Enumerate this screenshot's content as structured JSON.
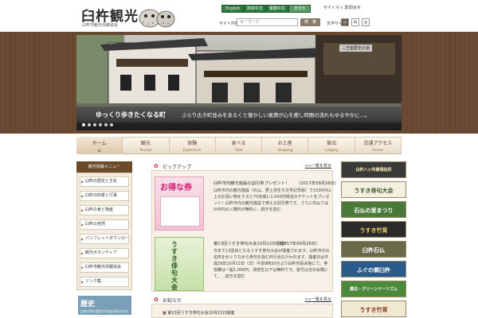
{
  "header": {
    "logo_title": "臼杵観光",
    "logo_sub": "臼杵市観光情報協会",
    "languages": [
      "English",
      "简体中文",
      "繁體中文",
      "한국어"
    ],
    "links": [
      "サイトマップ",
      "お問合せ"
    ],
    "search_label": "サイト内検索",
    "search_placeholder": "キーワード",
    "search_button": "検　索",
    "fontsize_label": "文字サイズ",
    "fontsizes": [
      "小",
      "中",
      "大"
    ]
  },
  "hero": {
    "caption_left": "ゆっくり歩きたくなる町",
    "caption": "ぶらり古き町並みをあるくと懐かしい風情が心を癒し時間の流れもゆるやかに…。",
    "tag": "二王座歴史の道",
    "slide_count": 6,
    "active_slide": 0
  },
  "nav": [
    {
      "jp": "ホーム",
      "en": ""
    },
    {
      "jp": "観光",
      "en": "Tourism"
    },
    {
      "jp": "体験",
      "en": "Experience"
    },
    {
      "jp": "食べる",
      "en": "Food"
    },
    {
      "jp": "お土産",
      "en": "Shopping"
    },
    {
      "jp": "宿泊",
      "en": "Lodging"
    },
    {
      "jp": "交通アクセス",
      "en": "Access"
    }
  ],
  "sidebar": {
    "title": "観光情報メニュー",
    "items": [
      "臼杵の歴史と文化",
      "臼杵の四季と行事",
      "臼杵の食と物産",
      "臼杵の自然",
      "パンフレットダウンロード",
      "観光ボランティア",
      "臼杵市観光情報協会",
      "リンク集"
    ],
    "banner_title": "歴史",
    "banner_text": "臼杵の町の歴史や文化を紹介する情報"
  },
  "main": {
    "pickup": {
      "title": "ピックアップ",
      "more": ">>一覧を見る",
      "articles": [
        {
          "image_text": "お得な券",
          "title": "臼杵市内観光施設の割引券プレゼント！",
          "date": "（2017年09月26日）",
          "body": "臼杵市内の観光施設（石仏、野上弥生子文学記念館）で1500円以上のお買い物をすると70名様に1,000円相当のチケットをプレゼント！臼杵市内の観光施設で使える割引券です。さらに石仏では540円の入場料が無料に…続きを読む"
        },
        {
          "image_text": "うすき俳句大会",
          "title": "第13回うすき俳句大会10月22日開催！",
          "date": "（2017年09月26日）",
          "body": "今年で13回目となるうすき俳句大会が開催されます。臼杵市内の名所をめぐりながら俳句を詠む吟行会も行われます。開催日は平成29年10月22日（日）午前9時30分より臼杵市民会館にて。参加費は一般1,000円、高校生以下は無料です。受付は当日会場にて。…続きを読む"
        }
      ]
    },
    "news": {
      "title": "お知らせ",
      "more": ">>一覧を見る",
      "items": [
        "第13回うすき俳句大会10月22日開催"
      ]
    }
  },
  "banners": [
    {
      "text": "臼杵八ヶ所霊場巡拝",
      "bg": "#3a3a3a",
      "fg": "#f5e8b0"
    },
    {
      "text": "うすき俳句大会",
      "bg": "#f4f0e0",
      "fg": "#3a5a2a"
    },
    {
      "text": "石仏の里まつり",
      "bg": "#4a7a3a",
      "fg": "#ffffff"
    },
    {
      "text": "うすき竹宵",
      "bg": "#2a2a2a",
      "fg": "#f0d070"
    },
    {
      "text": "臼杵石仏",
      "bg": "#6a6a4a",
      "fg": "#ffffff"
    },
    {
      "text": "ふぐの郷臼杵",
      "bg": "#2a5a8a",
      "fg": "#ffffff"
    },
    {
      "text": "農泊・グリーンツーリズム",
      "bg": "#4a8a3a",
      "fg": "#ffffff"
    },
    {
      "text": "うすき竹宵",
      "bg": "#f0e8d0",
      "fg": "#8a3a2a"
    }
  ]
}
